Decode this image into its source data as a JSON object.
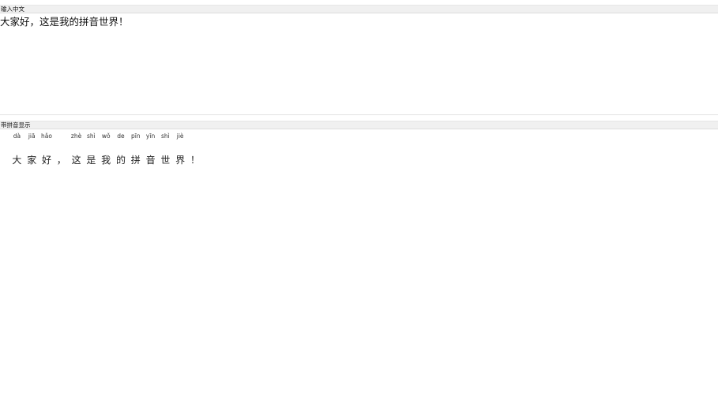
{
  "input_section": {
    "header": "输入中文",
    "value": "大家好，这是我的拼音世界！"
  },
  "pinyin_section": {
    "header": "带拼音显示",
    "cells": [
      {
        "pinyin": "dà",
        "hanzi": "大"
      },
      {
        "pinyin": "jiā",
        "hanzi": "家"
      },
      {
        "pinyin": "hǎo",
        "hanzi": "好"
      },
      {
        "pinyin": "",
        "hanzi": "，"
      },
      {
        "pinyin": "zhè",
        "hanzi": "这"
      },
      {
        "pinyin": "shì",
        "hanzi": "是"
      },
      {
        "pinyin": "wǒ",
        "hanzi": "我"
      },
      {
        "pinyin": "de",
        "hanzi": "的"
      },
      {
        "pinyin": "pīn",
        "hanzi": "拼"
      },
      {
        "pinyin": "yīn",
        "hanzi": "音"
      },
      {
        "pinyin": "shì",
        "hanzi": "世"
      },
      {
        "pinyin": "jiè",
        "hanzi": "界"
      },
      {
        "pinyin": "",
        "hanzi": "！"
      }
    ]
  }
}
